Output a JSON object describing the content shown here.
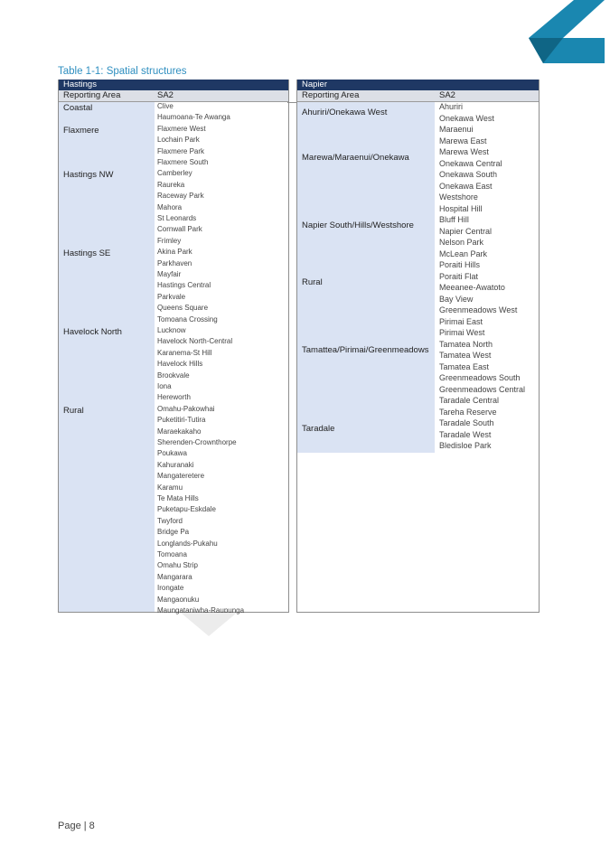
{
  "caption": "Table 1-1:  Spatial structures",
  "page_label": "Page | 8",
  "colors": {
    "header_bg": "#1f3864",
    "colhead_bg": "#dcdfe6",
    "area_bg": "#dae3f3",
    "caption": "#2f8fc0",
    "logo": "#1a87b0",
    "logo_dark": "#0f6585"
  },
  "hastings": {
    "title": "Hastings",
    "col_area": "Reporting Area",
    "col_sa2": "SA2",
    "areas": [
      {
        "name": "Coastal",
        "row": 0
      },
      {
        "name": "Flaxmere",
        "row": 2
      },
      {
        "name": "Hastings NW",
        "row": 6
      },
      {
        "name": "Hastings SE",
        "row": 13
      },
      {
        "name": "Havelock North",
        "row": 20
      },
      {
        "name": "Rural",
        "row": 27
      }
    ],
    "sa2": [
      "Clive",
      "Haumoana-Te Awanga",
      "Flaxmere West",
      "Lochain Park",
      "Flaxmere Park",
      "Flaxmere South",
      "Camberley",
      "Raureka",
      "Raceway Park",
      "Mahora",
      "St Leonards",
      "Cornwall Park",
      "Frimley",
      "Akina Park",
      "Parkhaven",
      "Mayfair",
      "Hastings Central",
      "Parkvale",
      "Queens Square",
      "Tomoana Crossing",
      "Lucknow",
      "Havelock North-Central",
      "Karanema-St Hill",
      "Havelock Hills",
      "Brookvale",
      "Iona",
      "Hereworth",
      "Omahu-Pakowhai",
      "Puketitiri-Tutira",
      "Maraekakaho",
      "Sherenden-Crownthorpe",
      "Poukawa",
      "Kahuranaki",
      "Mangateretere",
      "Karamu",
      "Te Mata Hills",
      "Puketapu-Eskdale",
      "Twyford",
      "Bridge Pa",
      "Longlands-Pukahu",
      "Tomoana",
      "Omahu Strip",
      "Mangarara",
      "Irongate",
      "Mangaonuku",
      "Maungataniwha-Raupunga"
    ]
  },
  "napier": {
    "title": "Napier",
    "col_area": "Reporting Area",
    "col_sa2": "SA2",
    "areas": [
      {
        "name": "Ahuriri/Onekawa West",
        "row": 0.5
      },
      {
        "name": "Marewa/Maraenui/Onekawa",
        "row": 4.5
      },
      {
        "name": "Napier South/Hills/Westshore",
        "row": 10.5
      },
      {
        "name": "Rural",
        "row": 15.5
      },
      {
        "name": "Tamattea/Pirimai/Greenmeadows",
        "row": 21.5
      },
      {
        "name": "Taradale",
        "row": 28.5
      }
    ],
    "sa2": [
      "Ahuriri",
      "Onekawa West",
      "Maraenui",
      "Marewa East",
      "Marewa West",
      "Onekawa Central",
      "Onekawa South",
      "Onekawa East",
      "Westshore",
      "Hospital Hill",
      "Bluff Hill",
      "Napier Central",
      "Nelson Park",
      "McLean Park",
      "Poraiti Hills",
      "Poraiti Flat",
      "Meeanee-Awatoto",
      "Bay View",
      "Greenmeadows West",
      "Pirimai East",
      "Pirimai West",
      "Tamatea North",
      "Tamatea West",
      "Tamatea East",
      "Greenmeadows South",
      "Greenmeadows Central",
      "Taradale Central",
      "Tareha Reserve",
      "Taradale South",
      "Taradale West",
      "Bledisloe Park"
    ]
  }
}
